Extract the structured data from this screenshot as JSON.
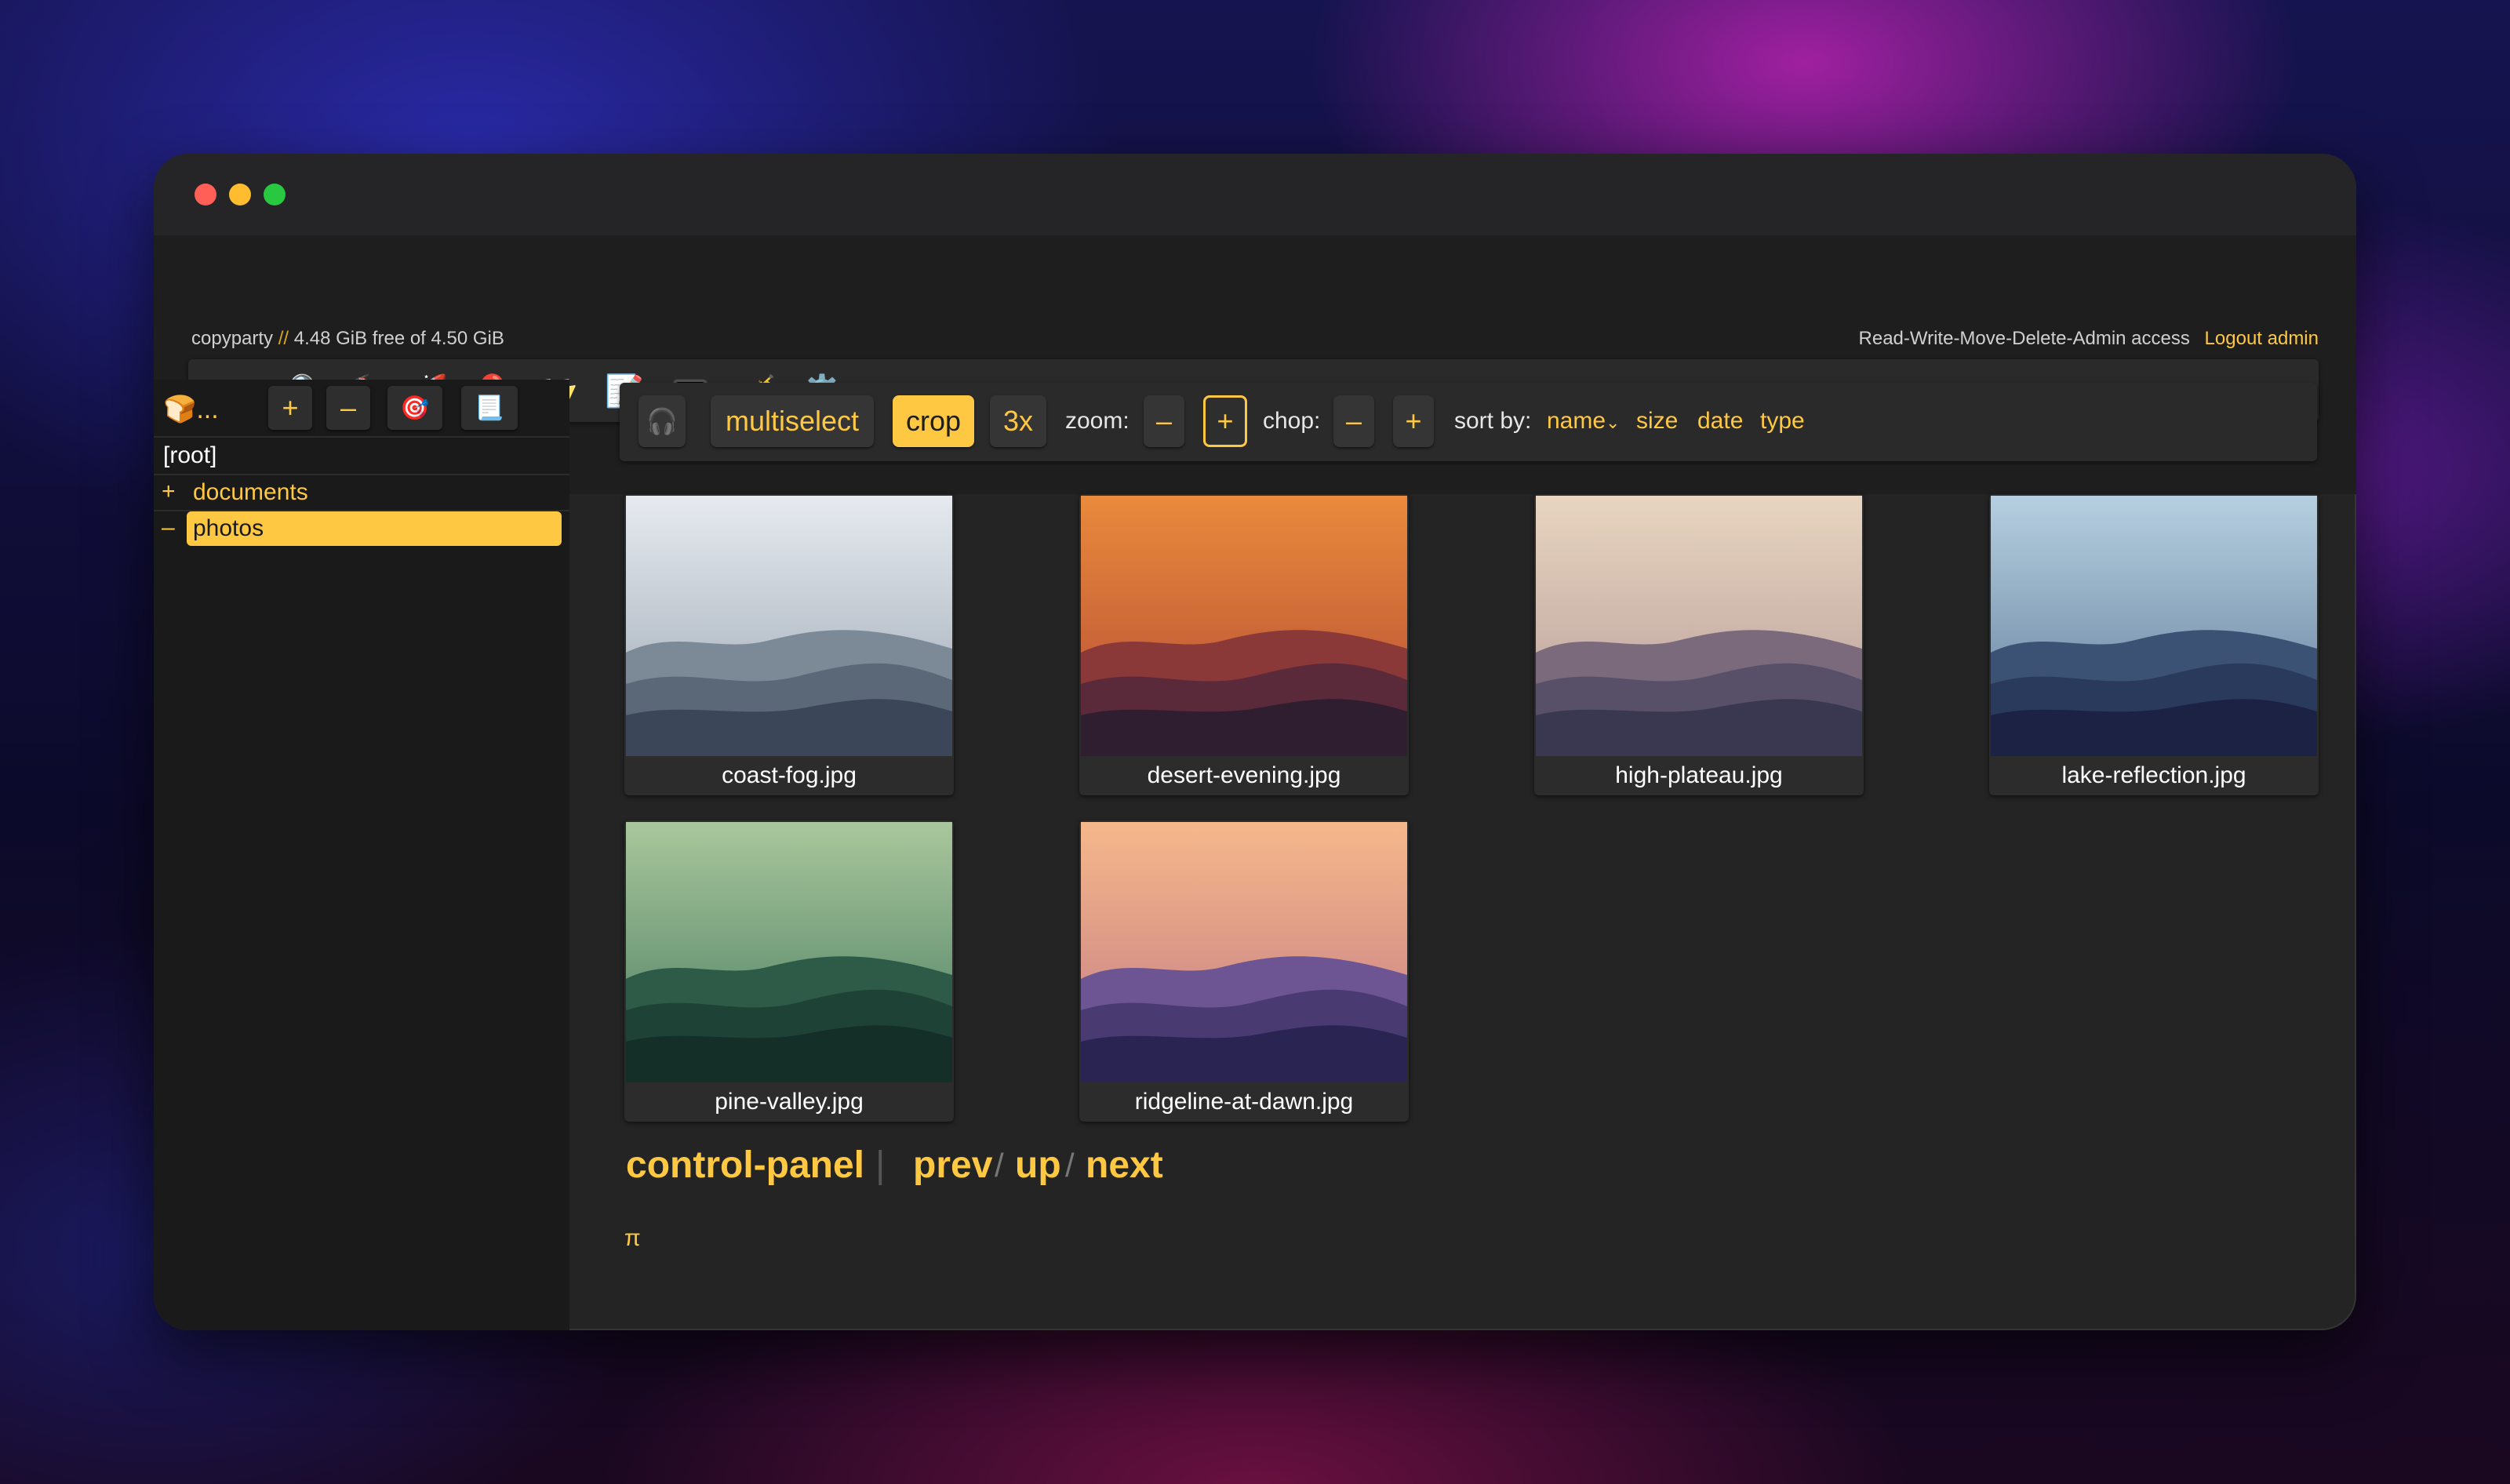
{
  "window": {
    "controls": [
      "close",
      "minimize",
      "maximize"
    ]
  },
  "status": {
    "app_name": "copyparty",
    "separator": "//",
    "free_space": "4.48 GiB free of 4.50 GiB",
    "access": "Read-Write-Move-Delete-Admin access",
    "logout": "Logout admin"
  },
  "ops": {
    "dash": "--",
    "icons": [
      "search-icon",
      "fire-extinguisher-icon",
      "rocket-icon",
      "balloon-icon",
      "folder-icon",
      "memo-icon",
      "terminal-icon",
      "trumpet-icon",
      "gear-icon"
    ],
    "glyphs": [
      "🔎",
      "🧯",
      "🚀",
      "🎈",
      "📂",
      "📝",
      "📟",
      "🎺",
      "⚙️"
    ]
  },
  "tree": {
    "head": "🍞...",
    "buttons": {
      "plus": "+",
      "minus": "–",
      "target": "🎯",
      "note": "📃"
    },
    "root": "[root]",
    "items": [
      {
        "pm": "+",
        "label": "documents",
        "active": false
      },
      {
        "pm": "–",
        "label": "photos",
        "active": true
      }
    ]
  },
  "toolbar": {
    "audio_icon": "🎧",
    "multiselect": "multiselect",
    "crop": "crop",
    "scale": "3x",
    "zoom_label": "zoom:",
    "zoom_minus": "–",
    "zoom_plus": "+",
    "chop_label": "chop:",
    "chop_minus": "–",
    "chop_plus": "+",
    "sort_label": "sort by:",
    "sort_name": "name",
    "sort_name_marker": "⌄",
    "sort_size": "size",
    "sort_date": "date",
    "sort_type": "type"
  },
  "files": [
    {
      "name": "coast-fog.jpg",
      "sky": [
        "#e6eaef",
        "#9aa6b3"
      ],
      "hills": [
        "#7c8a98",
        "#5b6878",
        "#3b4658"
      ]
    },
    {
      "name": "desert-evening.jpg",
      "sky": [
        "#e98a3c",
        "#b24a34"
      ],
      "hills": [
        "#8a3838",
        "#5a2a3a",
        "#2e1e30"
      ]
    },
    {
      "name": "high-plateau.jpg",
      "sky": [
        "#e8d5c0",
        "#b59a98"
      ],
      "hills": [
        "#7a6a7c",
        "#585068",
        "#3a3850"
      ]
    },
    {
      "name": "lake-reflection.jpg",
      "sky": [
        "#b6cfe0",
        "#5e7a98"
      ],
      "hills": [
        "#3c5274",
        "#2a3a5c",
        "#1c2244"
      ]
    },
    {
      "name": "pine-valley.jpg",
      "sky": [
        "#a9c79c",
        "#467a5e"
      ],
      "hills": [
        "#2e5a48",
        "#1e4236",
        "#142e28"
      ]
    },
    {
      "name": "ridgeline-at-dawn.jpg",
      "sky": [
        "#f5b88a",
        "#c27a86"
      ],
      "hills": [
        "#6c5592",
        "#4a3a72",
        "#2a2452"
      ]
    }
  ],
  "nav": {
    "control_panel": "control-panel",
    "divider": "|",
    "prev": "prev",
    "slash": "/",
    "up": "up",
    "next": "next"
  },
  "footer": {
    "pi": "π"
  }
}
